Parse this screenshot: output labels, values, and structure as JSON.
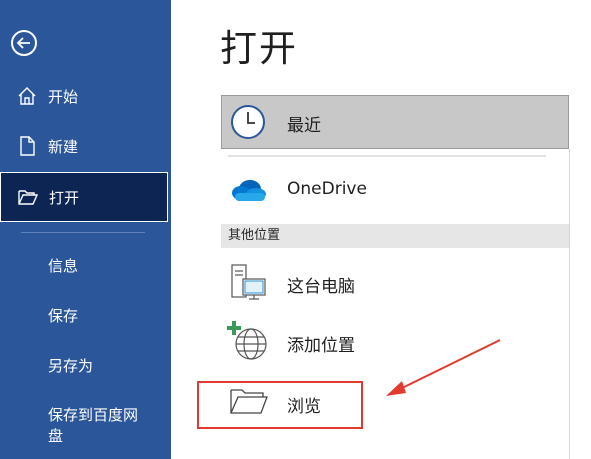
{
  "sidebar": {
    "back_label": "",
    "items": [
      {
        "label": "开始",
        "icon": "home-icon"
      },
      {
        "label": "新建",
        "icon": "new-document-icon"
      },
      {
        "label": "打开",
        "icon": "open-folder-icon",
        "active": true
      }
    ],
    "sub_items": [
      {
        "label": "信息"
      },
      {
        "label": "保存"
      },
      {
        "label": "另存为"
      },
      {
        "label": "保存到百度网盘"
      }
    ],
    "color": "#2b579a",
    "active_color": "#0c2552"
  },
  "main": {
    "title": "打开",
    "locations": [
      {
        "label": "最近",
        "icon": "clock-icon",
        "selected": true
      },
      {
        "label": "OneDrive",
        "icon": "onedrive-cloud-icon"
      }
    ],
    "other_header": "其他位置",
    "other_locations": [
      {
        "label": "这台电脑",
        "icon": "computer-icon"
      },
      {
        "label": "添加位置",
        "icon": "add-location-globe-icon"
      },
      {
        "label": "浏览",
        "icon": "folder-icon"
      }
    ]
  },
  "annotation": {
    "highlight_color": "#e23a2f"
  }
}
